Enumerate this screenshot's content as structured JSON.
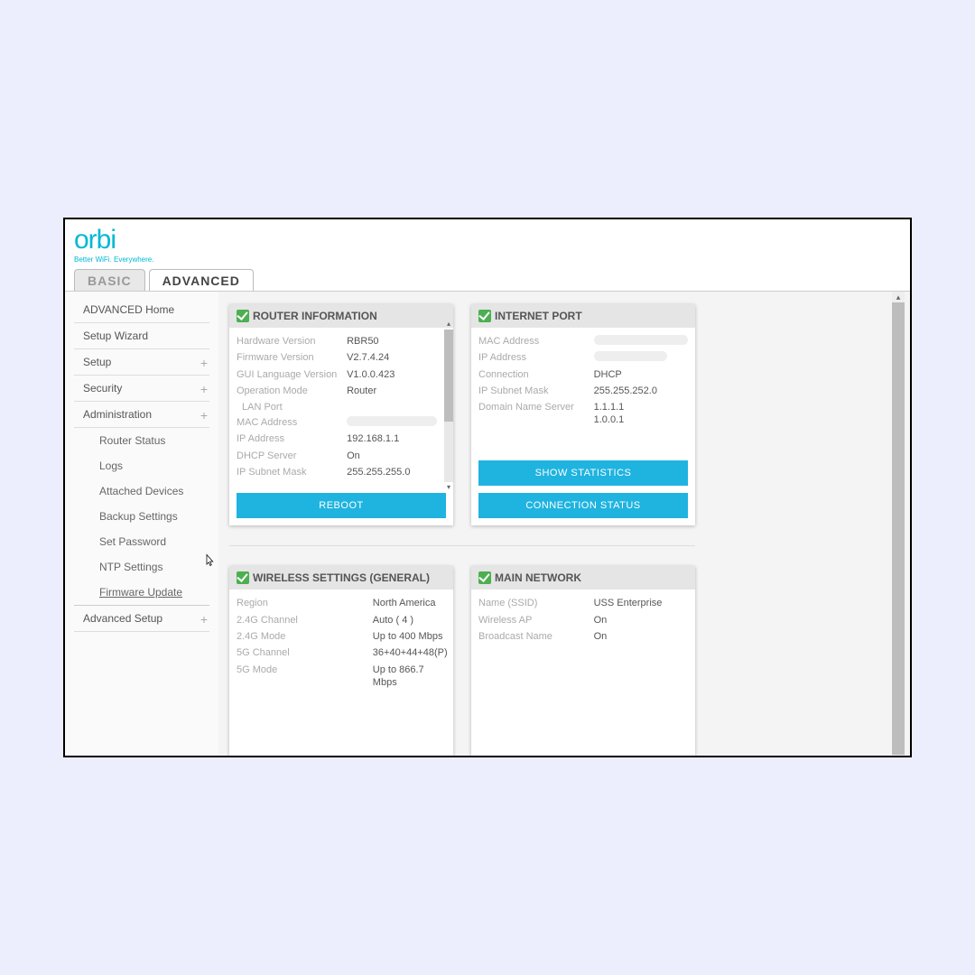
{
  "brand": {
    "name": "orbi",
    "tagline": "Better WiFi. Everywhere."
  },
  "tabs": {
    "basic": "BASIC",
    "advanced": "ADVANCED"
  },
  "sidebar": {
    "items": [
      {
        "label": "ADVANCED Home",
        "expand": false
      },
      {
        "label": "Setup Wizard",
        "expand": false
      },
      {
        "label": "Setup",
        "expand": true
      },
      {
        "label": "Security",
        "expand": true
      },
      {
        "label": "Administration",
        "expand": true
      }
    ],
    "subitems": [
      "Router Status",
      "Logs",
      "Attached Devices",
      "Backup Settings",
      "Set Password",
      "NTP Settings",
      "Firmware Update"
    ],
    "last": {
      "label": "Advanced Setup"
    }
  },
  "cards": {
    "router": {
      "title": "ROUTER INFORMATION",
      "rows": [
        {
          "k": "Hardware Version",
          "v": "RBR50"
        },
        {
          "k": "Firmware Version",
          "v": "V2.7.4.24"
        },
        {
          "k": "GUI Language Version",
          "v": "V1.0.0.423"
        },
        {
          "k": "Operation Mode",
          "v": "Router"
        }
      ],
      "lanLabel": "LAN Port",
      "lanRows": [
        {
          "k": "MAC Address",
          "v": "",
          "blur": true
        },
        {
          "k": "IP Address",
          "v": "192.168.1.1"
        },
        {
          "k": "DHCP Server",
          "v": "On"
        },
        {
          "k": "IP Subnet Mask",
          "v": "255.255.255.0"
        }
      ],
      "button": "REBOOT"
    },
    "internet": {
      "title": "INTERNET PORT",
      "rows": [
        {
          "k": "MAC Address",
          "v": "",
          "blur": true
        },
        {
          "k": "IP Address",
          "v": "",
          "blur": true
        },
        {
          "k": "Connection",
          "v": "DHCP"
        },
        {
          "k": "IP Subnet Mask",
          "v": "255.255.252.0"
        },
        {
          "k": "Domain Name Server",
          "v": "1.1.1.1\n1.0.0.1"
        }
      ],
      "btn1": "SHOW STATISTICS",
      "btn2": "CONNECTION STATUS"
    },
    "wireless": {
      "title": "WIRELESS SETTINGS (GENERAL)",
      "rows": [
        {
          "k": "Region",
          "v": "North America"
        },
        {
          "k": "2.4G Channel",
          "v": "Auto ( 4 )"
        },
        {
          "k": "2.4G Mode",
          "v": "Up to 400 Mbps"
        },
        {
          "k": "5G Channel",
          "v": "36+40+44+48(P)"
        },
        {
          "k": "5G Mode",
          "v": "Up to 866.7 Mbps"
        }
      ]
    },
    "mainnet": {
      "title": "MAIN NETWORK",
      "rows": [
        {
          "k": "Name (SSID)",
          "v": "USS Enterprise"
        },
        {
          "k": "Wireless AP",
          "v": "On"
        },
        {
          "k": "Broadcast Name",
          "v": "On"
        }
      ]
    }
  }
}
